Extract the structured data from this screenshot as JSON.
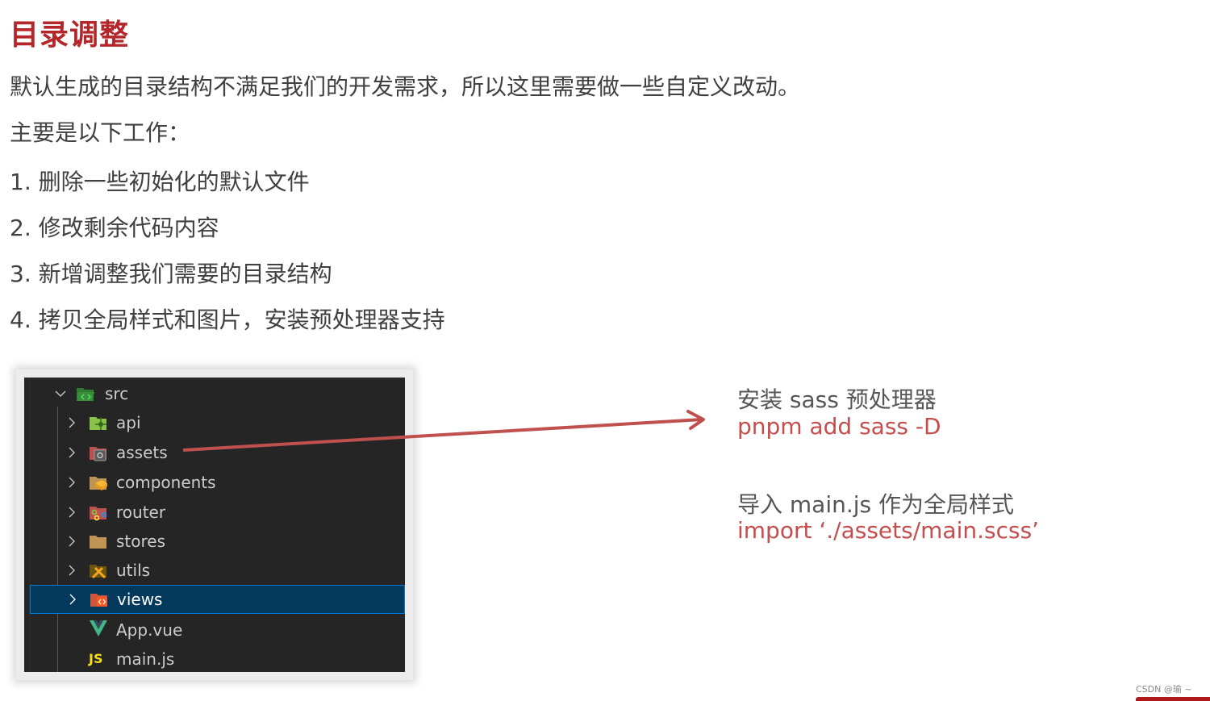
{
  "title": "目录调整",
  "intro": "默认生成的目录结构不满足我们的开发需求，所以这里需要做一些自定义改动。",
  "subheading": "主要是以下工作：",
  "tasks": [
    "1. 删除一些初始化的默认文件",
    "2. 修改剩余代码内容",
    "3. 新增调整我们需要的目录结构",
    "4. 拷贝全局样式和图片，安装预处理器支持"
  ],
  "explorer": {
    "root": {
      "name": "src",
      "icon": "folder-src-open-icon",
      "expanded": true
    },
    "items": [
      {
        "name": "api",
        "icon": "folder-api-icon",
        "type": "folder",
        "selected": false
      },
      {
        "name": "assets",
        "icon": "folder-assets-icon",
        "type": "folder",
        "selected": false
      },
      {
        "name": "components",
        "icon": "folder-components-icon",
        "type": "folder",
        "selected": false
      },
      {
        "name": "router",
        "icon": "folder-router-icon",
        "type": "folder",
        "selected": false
      },
      {
        "name": "stores",
        "icon": "folder-icon",
        "type": "folder",
        "selected": false
      },
      {
        "name": "utils",
        "icon": "folder-utils-icon",
        "type": "folder",
        "selected": false
      },
      {
        "name": "views",
        "icon": "folder-views-icon",
        "type": "folder",
        "selected": true
      },
      {
        "name": "App.vue",
        "icon": "vue-file-icon",
        "type": "file",
        "selected": false
      },
      {
        "name": "main.js",
        "icon": "js-file-icon",
        "type": "file",
        "selected": false
      }
    ],
    "js_badge": "JS"
  },
  "notes": {
    "install_label": "安装 sass 预处理器",
    "install_cmd": "pnpm add sass -D",
    "import_label": "导入 main.js 作为全局样式",
    "import_cmd": "import ‘./assets/main.scss’"
  },
  "colors": {
    "title": "#b4262a",
    "accent_red": "#c44d4d",
    "explorer_bg": "#252526",
    "selection_bg": "#04395e",
    "selection_border": "#0078d4"
  },
  "watermark": "CSDN @瑜 ~"
}
